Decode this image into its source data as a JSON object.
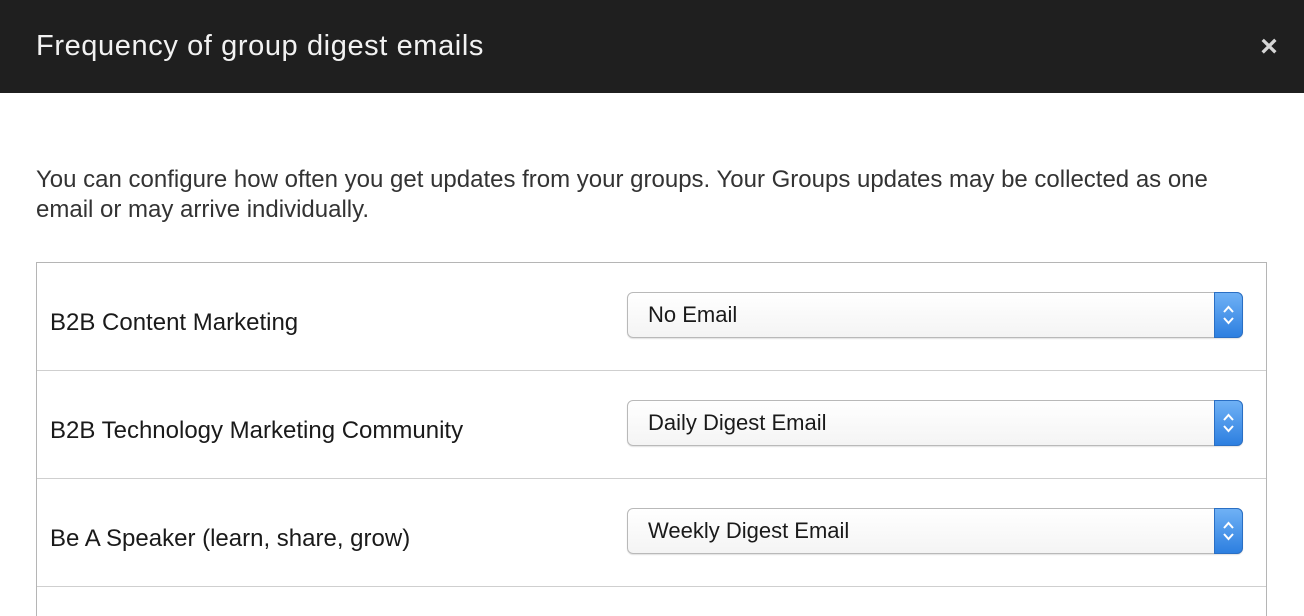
{
  "dialog": {
    "title": "Frequency of group digest emails",
    "close_glyph": "×",
    "description": "You can configure how often you get updates from your groups. Your Groups updates may be collected as one email or may arrive individually."
  },
  "groups": [
    {
      "name": "B2B Content Marketing",
      "frequency": "No Email"
    },
    {
      "name": "B2B Technology Marketing Community",
      "frequency": "Daily Digest Email"
    },
    {
      "name": "Be A Speaker (learn, share, grow)",
      "frequency": "Weekly Digest Email"
    }
  ],
  "colors": {
    "header_bg": "#1f1f1f",
    "header_text": "#f2f2f2",
    "stepper_accent": "#2d7fe0"
  },
  "icons": {
    "close": "close-icon",
    "select_stepper": "chevron-up-down-icon"
  }
}
